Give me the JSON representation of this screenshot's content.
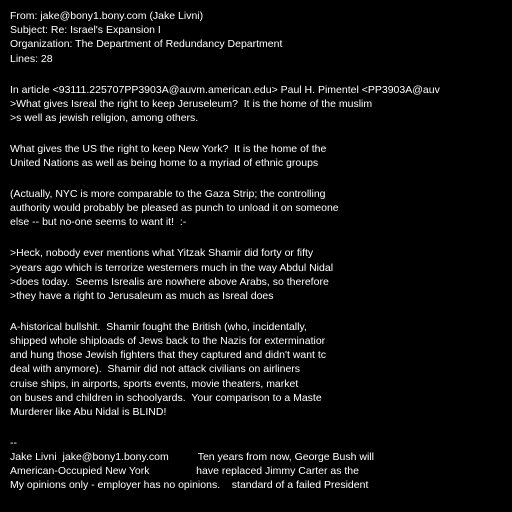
{
  "colors": {
    "background": "#000000",
    "text": "#ffffff"
  },
  "document": {
    "lines": [
      "From: jake@bony1.bony.com (Jake Livni)",
      "Subject: Re: Israel's Expansion I",
      "Organization: The Department of Redundancy Department",
      "Lines: 28",
      "",
      "In article <93111.225707PP3903A@auvm.american.edu> Paul H. Pimentel <PP3903A@auv",
      ">What gives Isreal the right to keep Jeruseleum?  It is the home of the muslim",
      ">s well as jewish religion, among others.",
      "",
      "What gives the US the right to keep New York?  It is the home of the",
      "United Nations as well as being home to a myriad of ethnic groups",
      "",
      "(Actually, NYC is more comparable to the Gaza Strip; the controlling",
      "authority would probably be pleased as punch to unload it on someone",
      "else -- but no-one seems to want it!  :-",
      "",
      ">Heck, nobody ever mentions what Yitzak Shamir did forty or fifty",
      ">years ago which is terrorize westerners much in the way Abdul Nidal",
      ">does today.  Seems Isrealis are nowhere above Arabs, so therefore",
      ">they have a right to Jerusaleum as much as Isreal does",
      "",
      "A-historical bullshit.  Shamir fought the British (who, incidentally,",
      "shipped whole shiploads of Jews back to the Nazis for exterminatior",
      "and hung those Jewish fighters that they captured and didn't want tc",
      "deal with anymore).  Shamir did not attack civilians on airliners",
      "cruise ships, in airports, sports events, movie theaters, market",
      "on buses and children in schoolyards.  Your comparison to a Maste",
      "Murderer like Abu Nidal is BLIND!",
      "",
      "--",
      "Jake Livni  jake@bony1.bony.com          Ten years from now, George Bush will",
      "American-Occupied New York                have replaced Jimmy Carter as the",
      "My opinions only - employer has no opinions.    standard of a failed President"
    ]
  }
}
